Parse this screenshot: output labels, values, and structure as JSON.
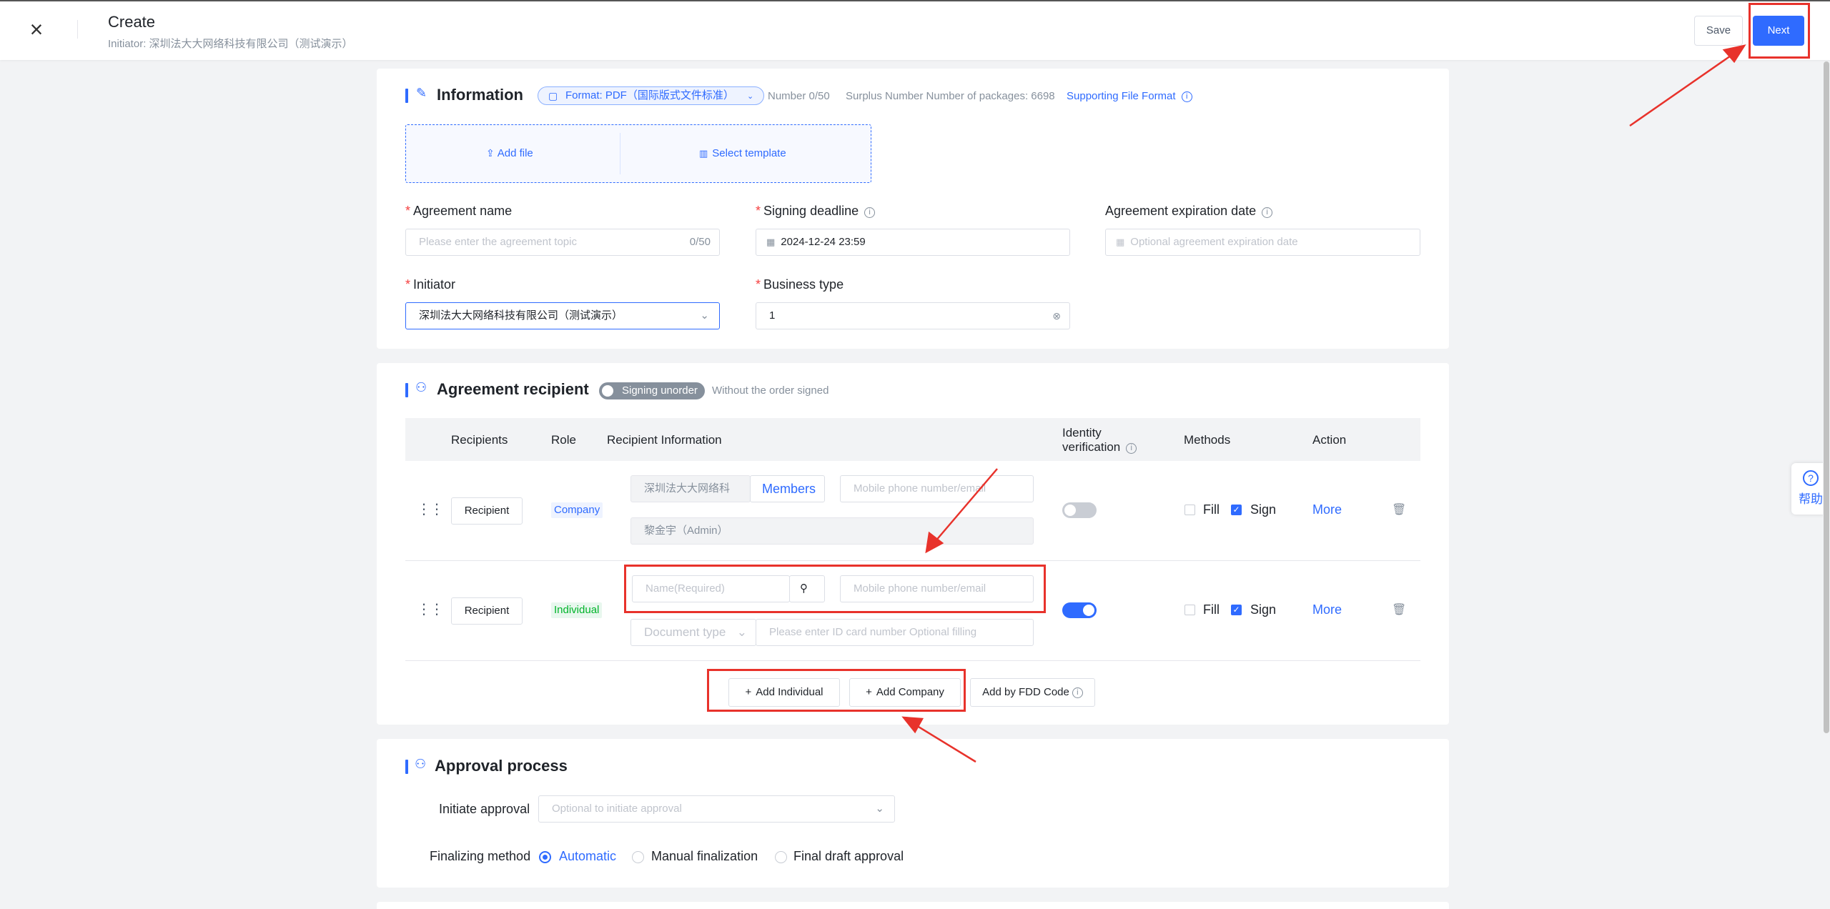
{
  "header": {
    "title": "Create",
    "subtitle": "Initiator: 深圳法大大网络科技有限公司（测试演示）",
    "save_label": "Save",
    "next_label": "Next"
  },
  "information": {
    "title": "Information",
    "format_label": "Format: PDF（国际版式文件标准）",
    "number": "Number 0/50",
    "surplus": "Surplus Number Number of packages: 6698",
    "supported_link": "Supporting File Format",
    "add_file": "Add file",
    "select_template": "Select template",
    "agreement_name_label": "Agreement name",
    "agreement_name_placeholder": "Please enter the agreement topic",
    "agreement_name_count": "0/50",
    "signing_deadline_label": "Signing deadline",
    "signing_deadline_value": "2024-12-24 23:59",
    "expiration_label": "Agreement expiration date",
    "expiration_placeholder": "Optional agreement expiration date",
    "initiator_label": "Initiator",
    "initiator_value": "深圳法大大网络科技有限公司（测试演示）",
    "business_type_label": "Business type",
    "business_type_value": "1"
  },
  "recipient": {
    "title": "Agreement recipient",
    "toggle_label": "Signing unorder",
    "toggle_desc": "Without the order signed",
    "headers": {
      "recipients": "Recipients",
      "role": "Role",
      "info": "Recipient Information",
      "identity_1": "Identity",
      "identity_2": "verification",
      "methods": "Methods",
      "action": "Action"
    },
    "rows": [
      {
        "recipient": "Recipient",
        "role": "Company",
        "company_name": "深圳法大大网络科",
        "members": "Members",
        "contact_placeholder": "Mobile phone number/email",
        "admin": "黎金宇（Admin）",
        "fill": "Fill",
        "sign": "Sign",
        "more": "More"
      },
      {
        "recipient": "Recipient",
        "role": "Individual",
        "name_placeholder": "Name(Required)",
        "contact_placeholder": "Mobile phone number/email",
        "doc_type": "Document type",
        "id_placeholder": "Please enter ID card number Optional filling",
        "fill": "Fill",
        "sign": "Sign",
        "more": "More"
      }
    ],
    "add_individual": "Add Individual",
    "add_company": "Add Company",
    "add_fdd": "Add by FDD Code"
  },
  "approval": {
    "title": "Approval process",
    "initiate_label": "Initiate approval",
    "initiate_placeholder": "Optional to initiate approval",
    "finalizing_label": "Finalizing method",
    "options": [
      "Automatic",
      "Manual finalization",
      "Final draft approval"
    ]
  },
  "help": {
    "label": "帮助"
  },
  "colors": {
    "primary": "#2f6bff",
    "annotation": "#e8322b"
  }
}
